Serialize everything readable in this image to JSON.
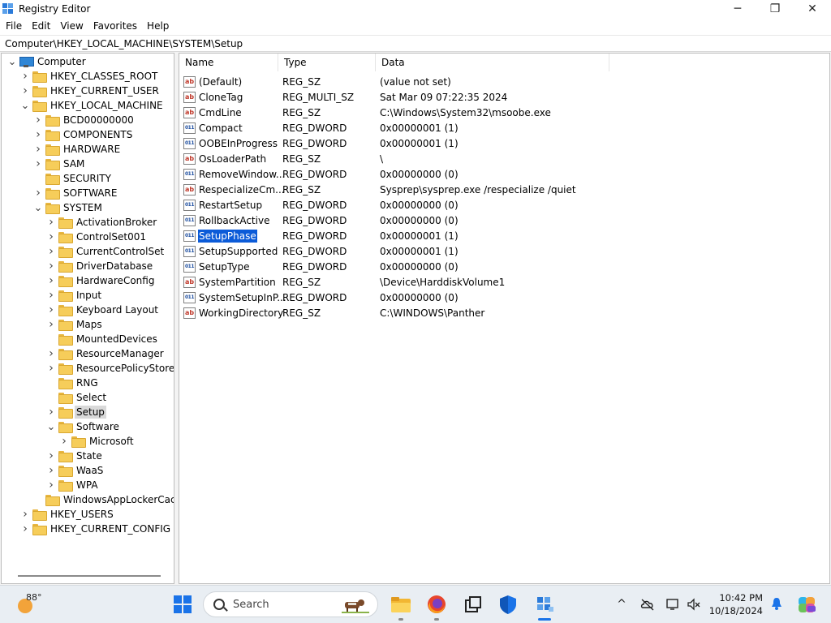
{
  "window": {
    "title": "Registry Editor",
    "minimize": "─",
    "maximize": "❐",
    "close": "✕"
  },
  "menu": [
    "File",
    "Edit",
    "View",
    "Favorites",
    "Help"
  ],
  "address": "Computer\\HKEY_LOCAL_MACHINE\\SYSTEM\\Setup",
  "tree": [
    {
      "label": "Computer",
      "chev": "v",
      "icon": "computer-icon"
    },
    {
      "label": "HKEY_CLASSES_ROOT",
      "chev": ">",
      "icon": "folder-icon"
    },
    {
      "label": "HKEY_CURRENT_USER",
      "chev": ">",
      "icon": "folder-icon"
    },
    {
      "label": "HKEY_LOCAL_MACHINE",
      "chev": "v",
      "icon": "folder-icon"
    },
    {
      "label": "BCD00000000",
      "chev": ">",
      "icon": "folder-icon"
    },
    {
      "label": "COMPONENTS",
      "chev": ">",
      "icon": "folder-icon"
    },
    {
      "label": "HARDWARE",
      "chev": ">",
      "icon": "folder-icon"
    },
    {
      "label": "SAM",
      "chev": ">",
      "icon": "folder-icon"
    },
    {
      "label": "SECURITY",
      "chev": "",
      "icon": "folder-icon"
    },
    {
      "label": "SOFTWARE",
      "chev": ">",
      "icon": "folder-icon"
    },
    {
      "label": "SYSTEM",
      "chev": "v",
      "icon": "folder-icon"
    },
    {
      "label": "ActivationBroker",
      "chev": ">",
      "icon": "folder-icon"
    },
    {
      "label": "ControlSet001",
      "chev": ">",
      "icon": "folder-icon"
    },
    {
      "label": "CurrentControlSet",
      "chev": ">",
      "icon": "folder-icon"
    },
    {
      "label": "DriverDatabase",
      "chev": ">",
      "icon": "folder-icon"
    },
    {
      "label": "HardwareConfig",
      "chev": ">",
      "icon": "folder-icon"
    },
    {
      "label": "Input",
      "chev": ">",
      "icon": "folder-icon"
    },
    {
      "label": "Keyboard Layout",
      "chev": ">",
      "icon": "folder-icon"
    },
    {
      "label": "Maps",
      "chev": ">",
      "icon": "folder-icon"
    },
    {
      "label": "MountedDevices",
      "chev": "",
      "icon": "folder-icon"
    },
    {
      "label": "ResourceManager",
      "chev": ">",
      "icon": "folder-icon"
    },
    {
      "label": "ResourcePolicyStore",
      "chev": ">",
      "icon": "folder-icon"
    },
    {
      "label": "RNG",
      "chev": "",
      "icon": "folder-icon"
    },
    {
      "label": "Select",
      "chev": "",
      "icon": "folder-icon"
    },
    {
      "label": "Setup",
      "chev": ">",
      "icon": "folder-icon",
      "selected": true
    },
    {
      "label": "Software",
      "chev": "v",
      "icon": "folder-icon"
    },
    {
      "label": "Microsoft",
      "chev": ">",
      "icon": "folder-icon"
    },
    {
      "label": "State",
      "chev": ">",
      "icon": "folder-icon"
    },
    {
      "label": "WaaS",
      "chev": ">",
      "icon": "folder-icon"
    },
    {
      "label": "WPA",
      "chev": ">",
      "icon": "folder-icon"
    },
    {
      "label": "WindowsAppLockerCache",
      "chev": "",
      "icon": "folder-icon"
    },
    {
      "label": "HKEY_USERS",
      "chev": ">",
      "icon": "folder-icon"
    },
    {
      "label": "HKEY_CURRENT_CONFIG",
      "chev": ">",
      "icon": "folder-icon"
    }
  ],
  "list": {
    "columns": [
      "Name",
      "Type",
      "Data"
    ],
    "rows": [
      {
        "name": "(Default)",
        "type": "REG_SZ",
        "data": "(value not set)",
        "icon": "string-value-icon"
      },
      {
        "name": "CloneTag",
        "type": "REG_MULTI_SZ",
        "data": "Sat Mar 09 07:22:35 2024",
        "icon": "string-value-icon"
      },
      {
        "name": "CmdLine",
        "type": "REG_SZ",
        "data": "C:\\Windows\\System32\\msoobe.exe",
        "icon": "string-value-icon"
      },
      {
        "name": "Compact",
        "type": "REG_DWORD",
        "data": "0x00000001 (1)",
        "icon": "dword-value-icon"
      },
      {
        "name": "OOBEInProgress",
        "type": "REG_DWORD",
        "data": "0x00000001 (1)",
        "icon": "dword-value-icon"
      },
      {
        "name": "OsLoaderPath",
        "type": "REG_SZ",
        "data": "\\",
        "icon": "string-value-icon"
      },
      {
        "name": "RemoveWindow...",
        "type": "REG_DWORD",
        "data": "0x00000000 (0)",
        "icon": "dword-value-icon"
      },
      {
        "name": "RespecializeCm...",
        "type": "REG_SZ",
        "data": "Sysprep\\sysprep.exe /respecialize /quiet",
        "icon": "string-value-icon"
      },
      {
        "name": "RestartSetup",
        "type": "REG_DWORD",
        "data": "0x00000000 (0)",
        "icon": "dword-value-icon"
      },
      {
        "name": "RollbackActive",
        "type": "REG_DWORD",
        "data": "0x00000000 (0)",
        "icon": "dword-value-icon"
      },
      {
        "name": "SetupPhase",
        "type": "REG_DWORD",
        "data": "0x00000001 (1)",
        "icon": "dword-value-icon",
        "selected": true
      },
      {
        "name": "SetupSupported",
        "type": "REG_DWORD",
        "data": "0x00000001 (1)",
        "icon": "dword-value-icon"
      },
      {
        "name": "SetupType",
        "type": "REG_DWORD",
        "data": "0x00000000 (0)",
        "icon": "dword-value-icon"
      },
      {
        "name": "SystemPartition",
        "type": "REG_SZ",
        "data": "\\Device\\HarddiskVolume1",
        "icon": "string-value-icon"
      },
      {
        "name": "SystemSetupInP...",
        "type": "REG_DWORD",
        "data": "0x00000000 (0)",
        "icon": "dword-value-icon"
      },
      {
        "name": "WorkingDirectory",
        "type": "REG_SZ",
        "data": "C:\\WINDOWS\\Panther",
        "icon": "string-value-icon"
      }
    ]
  },
  "icon_text": {
    "string": "ab",
    "dword": "011\n110"
  },
  "taskbar": {
    "temperature": "88°",
    "search_placeholder": "Search",
    "time": "10:42 PM",
    "date": "10/18/2024",
    "tray_chevron": "^"
  },
  "colors": {
    "selection": "#0b5bd8",
    "accent": "#1a73e8",
    "folder": "#f6cd5a"
  }
}
